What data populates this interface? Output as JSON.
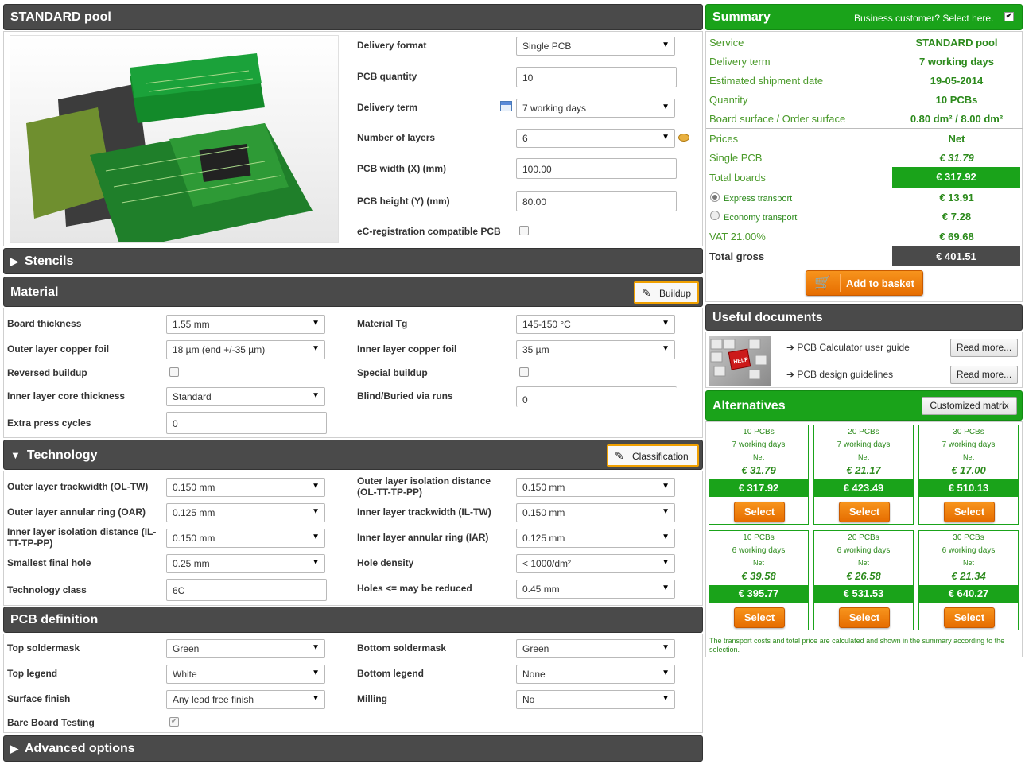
{
  "standard_pool": {
    "title": "STANDARD pool",
    "fields": {
      "delivery_format": {
        "label": "Delivery format",
        "value": "Single PCB"
      },
      "pcb_quantity": {
        "label": "PCB quantity",
        "value": "10"
      },
      "delivery_term": {
        "label": "Delivery term",
        "value": "7 working days"
      },
      "layers": {
        "label": "Number of layers",
        "value": "6"
      },
      "pcb_width": {
        "label": "PCB width (X) (mm)",
        "value": "100.00"
      },
      "pcb_height": {
        "label": "PCB height (Y) (mm)",
        "value": "80.00"
      },
      "ec_registration": {
        "label": "eC-registration compatible PCB",
        "checked": false
      }
    }
  },
  "stencils": {
    "title": "Stencils"
  },
  "material": {
    "title": "Material",
    "buildup_button": "Buildup",
    "board_thickness": {
      "label": "Board thickness",
      "value": "1.55 mm"
    },
    "material_tg": {
      "label": "Material Tg",
      "value": "145-150 °C"
    },
    "outer_copper": {
      "label": "Outer layer copper foil",
      "value": "18 µm (end +/-35 µm)"
    },
    "inner_copper": {
      "label": "Inner layer copper foil",
      "value": "35 µm"
    },
    "reversed_buildup": {
      "label": "Reversed buildup",
      "checked": false
    },
    "special_buildup": {
      "label": "Special buildup",
      "checked": false
    },
    "inner_core": {
      "label": "Inner layer core thickness",
      "value": "Standard"
    },
    "blind_buried": {
      "label": "Blind/Buried via runs",
      "value": "0"
    },
    "extra_press": {
      "label": "Extra press cycles",
      "value": "0"
    }
  },
  "technology": {
    "title": "Technology",
    "classification_button": "Classification",
    "ol_tw": {
      "label": "Outer layer trackwidth (OL-TW)",
      "value": "0.150 mm"
    },
    "ol_isolation": {
      "label": "Outer layer isolation distance (OL-TT-TP-PP)",
      "value": "0.150 mm"
    },
    "oar": {
      "label": "Outer layer annular ring (OAR)",
      "value": "0.125 mm"
    },
    "il_tw": {
      "label": "Inner layer trackwidth (IL-TW)",
      "value": "0.150 mm"
    },
    "il_isolation": {
      "label": "Inner layer isolation distance (IL-TT-TP-PP)",
      "value": "0.150 mm"
    },
    "iar": {
      "label": "Inner layer annular ring (IAR)",
      "value": "0.125 mm"
    },
    "smallest_hole": {
      "label": "Smallest final hole",
      "value": "0.25 mm"
    },
    "hole_density": {
      "label": "Hole density",
      "value": "< 1000/dm²"
    },
    "tech_class": {
      "label": "Technology class",
      "value": "6C"
    },
    "holes_reduced": {
      "label": "Holes <= may be reduced",
      "value": "0.45 mm"
    }
  },
  "pcb_definition": {
    "title": "PCB definition",
    "top_soldermask": {
      "label": "Top soldermask",
      "value": "Green"
    },
    "bottom_soldermask": {
      "label": "Bottom soldermask",
      "value": "Green"
    },
    "top_legend": {
      "label": "Top legend",
      "value": "White"
    },
    "bottom_legend": {
      "label": "Bottom legend",
      "value": "None"
    },
    "surface_finish": {
      "label": "Surface finish",
      "value": "Any lead free finish"
    },
    "milling": {
      "label": "Milling",
      "value": "No"
    },
    "bare_board": {
      "label": "Bare Board Testing",
      "checked": true
    }
  },
  "advanced": {
    "title": "Advanced options"
  },
  "summary": {
    "title": "Summary",
    "business": "Business customer? Select here.",
    "rows": {
      "service": {
        "k": "Service",
        "v": "STANDARD pool"
      },
      "delivery_term": {
        "k": "Delivery term",
        "v": "7 working days"
      },
      "shipment": {
        "k": "Estimated shipment date",
        "v": "19-05-2014"
      },
      "quantity": {
        "k": "Quantity",
        "v": "10 PCBs"
      },
      "surface": {
        "k": "Board surface / Order surface",
        "v": "0.80 dm² / 8.00 dm²"
      },
      "prices": {
        "k": "Prices",
        "v": "Net"
      },
      "single": {
        "k": "Single PCB",
        "v": "€ 31.79"
      },
      "total_boards": {
        "k": "Total boards",
        "v": "€ 317.92"
      },
      "express": {
        "k": "Express transport",
        "v": "€ 13.91"
      },
      "economy": {
        "k": "Economy transport",
        "v": "€ 7.28"
      },
      "vat": {
        "k": "VAT 21.00%",
        "v": "€ 69.68"
      },
      "gross": {
        "k": "Total gross",
        "v": "€ 401.51"
      }
    },
    "add_to_basket": "Add to basket"
  },
  "documents": {
    "title": "Useful documents",
    "items": [
      {
        "label": "➔ PCB Calculator user guide",
        "button": "Read more..."
      },
      {
        "label": "➔ PCB design guidelines",
        "button": "Read more..."
      }
    ]
  },
  "alternatives": {
    "title": "Alternatives",
    "customized": "Customized matrix",
    "cards": [
      {
        "qty": "10 PCBs",
        "term": "7 working days",
        "net_label": "Net",
        "net": "€ 31.79",
        "gross": "€ 317.92",
        "btn": "Select"
      },
      {
        "qty": "20 PCBs",
        "term": "7 working days",
        "net_label": "Net",
        "net": "€ 21.17",
        "gross": "€ 423.49",
        "btn": "Select"
      },
      {
        "qty": "30 PCBs",
        "term": "7 working days",
        "net_label": "Net",
        "net": "€ 17.00",
        "gross": "€ 510.13",
        "btn": "Select"
      },
      {
        "qty": "10 PCBs",
        "term": "6 working days",
        "net_label": "Net",
        "net": "€ 39.58",
        "gross": "€ 395.77",
        "btn": "Select"
      },
      {
        "qty": "20 PCBs",
        "term": "6 working days",
        "net_label": "Net",
        "net": "€ 26.58",
        "gross": "€ 531.53",
        "btn": "Select"
      },
      {
        "qty": "30 PCBs",
        "term": "6 working days",
        "net_label": "Net",
        "net": "€ 21.34",
        "gross": "€ 640.27",
        "btn": "Select"
      }
    ],
    "note": "The transport costs and total price are calculated and shown in the summary according to the selection."
  },
  "colors": {
    "accent_green": "#1aa31a",
    "header_dark": "#4a4a4a",
    "orange": "#f7941d"
  }
}
